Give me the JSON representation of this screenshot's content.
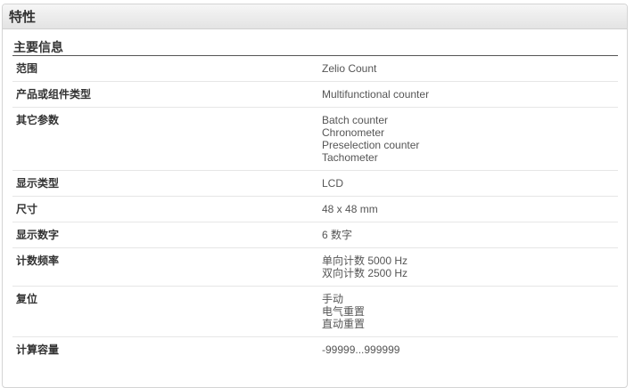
{
  "panel": {
    "title": "特性"
  },
  "section": {
    "title": "主要信息"
  },
  "rows": [
    {
      "label": "范围",
      "values": [
        "Zelio Count"
      ]
    },
    {
      "label": "产品或组件类型",
      "values": [
        "Multifunctional counter"
      ]
    },
    {
      "label": "其它参数",
      "values": [
        "Batch counter",
        "Chronometer",
        "Preselection counter",
        "Tachometer"
      ]
    },
    {
      "label": "显示类型",
      "values": [
        "LCD"
      ]
    },
    {
      "label": "尺寸",
      "values": [
        "48 x 48 mm"
      ]
    },
    {
      "label": "显示数字",
      "values": [
        "6 数字"
      ]
    },
    {
      "label": "计数频率",
      "values": [
        "单向计数 5000 Hz",
        "双向计数 2500 Hz"
      ]
    },
    {
      "label": "复位",
      "values": [
        "手动",
        "电气重置",
        "直动重置"
      ]
    },
    {
      "label": "计算容量",
      "values": [
        "-99999...999999"
      ]
    }
  ]
}
